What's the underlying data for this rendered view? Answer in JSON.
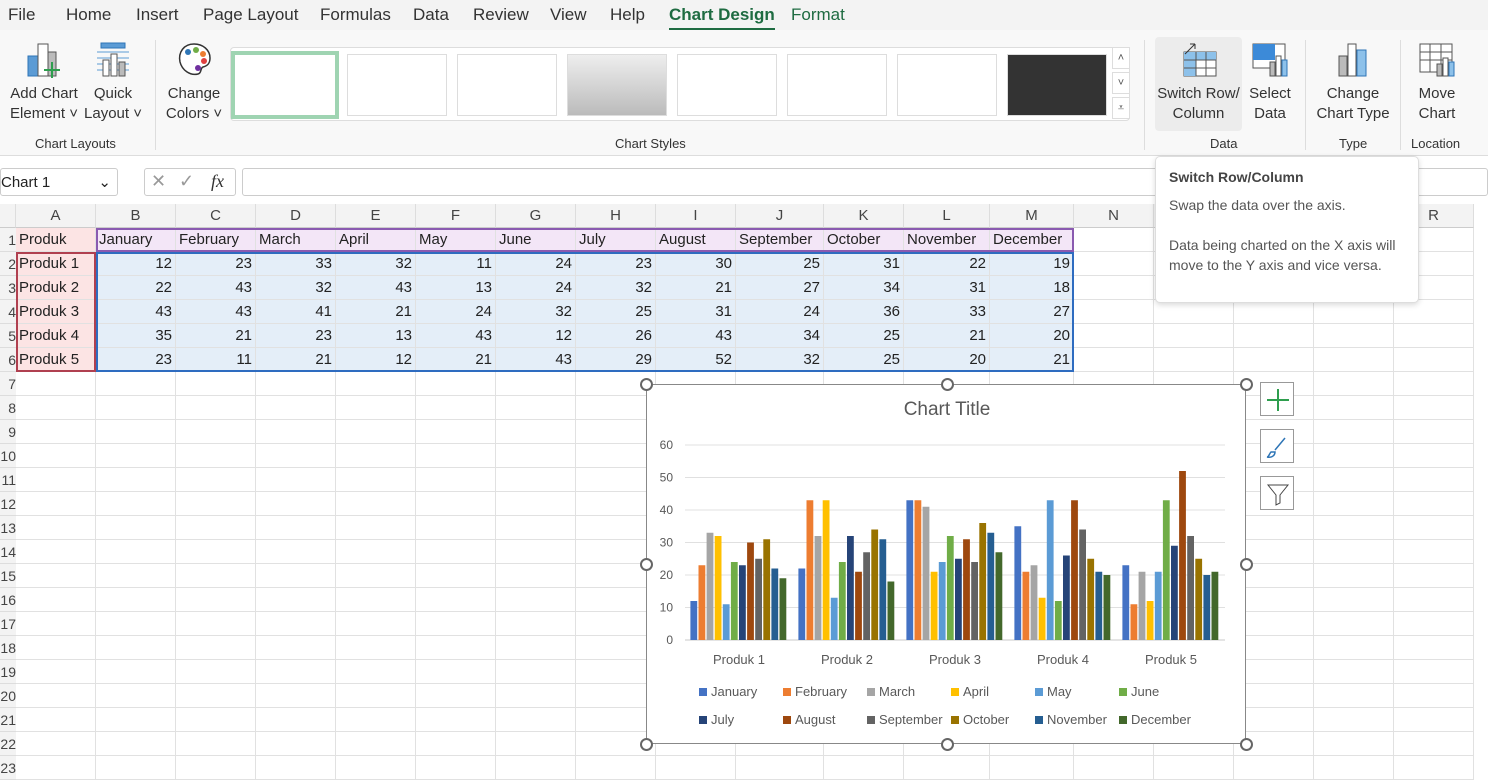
{
  "menu": [
    "File",
    "Home",
    "Insert",
    "Page Layout",
    "Formulas",
    "Data",
    "Review",
    "View",
    "Help",
    "Chart Design",
    "Format"
  ],
  "ribbon": {
    "add_chart_element": [
      "Add Chart",
      "Element ˅"
    ],
    "quick_layout": [
      "Quick",
      "Layout ˅"
    ],
    "change_colors": [
      "Change",
      "Colors ˅"
    ],
    "group_chart_layouts": "Chart Layouts",
    "group_chart_styles": "Chart Styles",
    "switch_row_col": [
      "Switch Row/",
      "Column"
    ],
    "select_data": [
      "Select",
      "Data"
    ],
    "group_data": "Data",
    "change_chart_type": [
      "Change",
      "Chart Type"
    ],
    "group_type": "Type",
    "move_chart": [
      "Move",
      "Chart"
    ],
    "group_location": "Location"
  },
  "formula_bar": {
    "name_box": "Chart 1",
    "fx": "fx",
    "value": ""
  },
  "tooltip": {
    "title": "Switch Row/Column",
    "line1": "Swap the data over the axis.",
    "line2": "Data being charted on the X axis will move to the Y axis and vice versa."
  },
  "columns": [
    "A",
    "B",
    "C",
    "D",
    "E",
    "F",
    "G",
    "H",
    "I",
    "J",
    "K",
    "L",
    "M",
    "N",
    "O",
    "P",
    "Q",
    "R"
  ],
  "rows": [
    "1",
    "2",
    "3",
    "4",
    "5",
    "6",
    "7",
    "8",
    "9",
    "10",
    "11",
    "12",
    "13",
    "14",
    "15",
    "16",
    "17",
    "18",
    "19",
    "20",
    "21",
    "22",
    "23"
  ],
  "table": {
    "header": [
      "Produk",
      "January",
      "February",
      "March",
      "April",
      "May",
      "June",
      "July",
      "August",
      "September",
      "October",
      "November",
      "December"
    ],
    "rows": [
      [
        "Produk 1",
        12,
        23,
        33,
        32,
        11,
        24,
        23,
        30,
        25,
        31,
        22,
        19
      ],
      [
        "Produk 2",
        22,
        43,
        32,
        43,
        13,
        24,
        32,
        21,
        27,
        34,
        31,
        18
      ],
      [
        "Produk 3",
        43,
        43,
        41,
        21,
        24,
        32,
        25,
        31,
        24,
        36,
        33,
        27
      ],
      [
        "Produk 4",
        35,
        21,
        23,
        13,
        43,
        12,
        26,
        43,
        34,
        25,
        21,
        20
      ],
      [
        "Produk 5",
        23,
        11,
        21,
        12,
        21,
        43,
        29,
        52,
        32,
        25,
        20,
        21
      ]
    ]
  },
  "chart_data": {
    "type": "bar",
    "title": "Chart Title",
    "categories": [
      "Produk 1",
      "Produk 2",
      "Produk 3",
      "Produk 4",
      "Produk 5"
    ],
    "ylim": [
      0,
      60
    ],
    "yticks": [
      0,
      10,
      20,
      30,
      40,
      50,
      60
    ],
    "grid": true,
    "legend": "bottom",
    "series": [
      {
        "name": "January",
        "color": "#4472C4",
        "values": [
          12,
          22,
          43,
          35,
          23
        ]
      },
      {
        "name": "February",
        "color": "#ED7D31",
        "values": [
          23,
          43,
          43,
          21,
          11
        ]
      },
      {
        "name": "March",
        "color": "#A5A5A5",
        "values": [
          33,
          32,
          41,
          23,
          21
        ]
      },
      {
        "name": "April",
        "color": "#FFC000",
        "values": [
          32,
          43,
          21,
          13,
          12
        ]
      },
      {
        "name": "May",
        "color": "#5B9BD5",
        "values": [
          11,
          13,
          24,
          43,
          21
        ]
      },
      {
        "name": "June",
        "color": "#70AD47",
        "values": [
          24,
          24,
          32,
          12,
          43
        ]
      },
      {
        "name": "July",
        "color": "#264478",
        "values": [
          23,
          32,
          25,
          26,
          29
        ]
      },
      {
        "name": "August",
        "color": "#9E480E",
        "values": [
          30,
          21,
          31,
          43,
          52
        ]
      },
      {
        "name": "September",
        "color": "#636363",
        "values": [
          25,
          27,
          24,
          34,
          32
        ]
      },
      {
        "name": "October",
        "color": "#997300",
        "values": [
          31,
          34,
          36,
          25,
          25
        ]
      },
      {
        "name": "November",
        "color": "#255E91",
        "values": [
          22,
          31,
          33,
          21,
          20
        ]
      },
      {
        "name": "December",
        "color": "#43682B",
        "values": [
          19,
          18,
          27,
          20,
          21
        ]
      }
    ]
  }
}
